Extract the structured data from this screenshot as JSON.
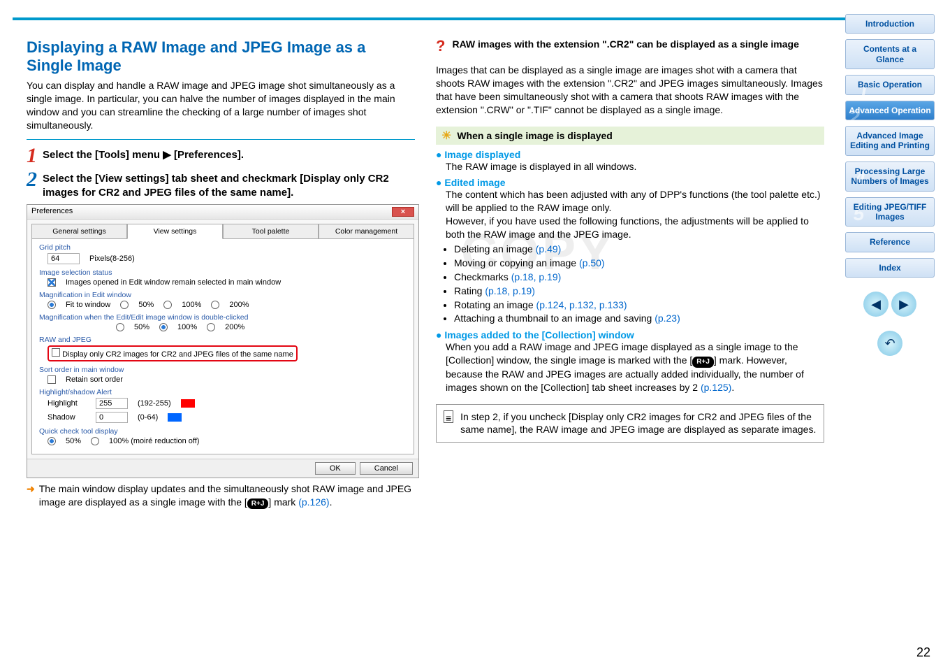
{
  "title": "Displaying a RAW Image and JPEG Image as a Single Image",
  "lead": "You can display and handle a RAW image and JPEG image shot simultaneously as a single image. In particular, you can halve the number of images displayed in the main window and you can streamline the checking of a large number of images shot simultaneously.",
  "step1": "Select the [Tools] menu ▶ [Preferences].",
  "step2": "Select the [View settings] tab sheet and checkmark [Display only CR2 images for CR2 and JPEG files of the same name].",
  "dlg": {
    "title": "Preferences",
    "tabs": [
      "General settings",
      "View settings",
      "Tool palette",
      "Color management"
    ],
    "grid_pitch": {
      "label": "Grid pitch",
      "value": "64",
      "hint": "Pixels(8-256)"
    },
    "sel_status": {
      "label": "Image selection status",
      "chk": "Images opened in Edit window remain selected in main window"
    },
    "mag_edit": {
      "label": "Magnification in Edit window",
      "opts": [
        "Fit to window",
        "50%",
        "100%",
        "200%"
      ]
    },
    "mag_dbl": {
      "label": "Magnification when the Edit/Edit image window is double-clicked",
      "opts": [
        "50%",
        "100%",
        "200%"
      ]
    },
    "rawjpeg": {
      "label": "RAW and JPEG",
      "chk": "Display only CR2 images for CR2 and JPEG files of the same name"
    },
    "sort": {
      "label": "Sort order in main window",
      "chk": "Retain sort order"
    },
    "hl": {
      "label": "Highlight/shadow Alert",
      "hi": "Highlight",
      "hiv": "255",
      "hir": "(192-255)",
      "sh": "Shadow",
      "shv": "0",
      "shr": "(0-64)"
    },
    "quick": {
      "label": "Quick check tool display",
      "o1": "50%",
      "o2": "100% (moiré reduction off)"
    },
    "ok": "OK",
    "cancel": "Cancel"
  },
  "after": "The main window display updates and the simultaneously shot RAW image and JPEG image are displayed as a single image with the [",
  "after2": "] mark ",
  "after_link": "(p.126)",
  "after3": ".",
  "rcol": {
    "q": "RAW images with the extension \".CR2\" can be displayed as a single image",
    "qbody": "Images that can be displayed as a single image are images shot with a camera that shoots RAW images with the extension \".CR2\" and JPEG images simultaneously. Images that have been simultaneously shot with a camera that shoots RAW images with the extension \".CRW\" or \".TIF\" cannot be displayed as a single image.",
    "tip": "When a single image is displayed",
    "disp_h": "Image displayed",
    "disp": "The RAW image is displayed in all windows.",
    "edit_h": "Edited image",
    "edit": "The content which has been adjusted with any of DPP's functions (the tool palette etc.) will be applied to the RAW image only.\nHowever, if you have used the following functions, the adjustments will be applied to both the RAW image and the JPEG image.",
    "items": [
      {
        "t": "Deleting an image ",
        "l": "(p.49)"
      },
      {
        "t": "Moving or copying an image ",
        "l": "(p.50)"
      },
      {
        "t": "Checkmarks ",
        "l": "(p.18, p.19)"
      },
      {
        "t": "Rating ",
        "l": "(p.18, p.19)"
      },
      {
        "t": "Rotating an image ",
        "l": "(p.124, p.132, p.133)"
      },
      {
        "t": "Attaching a thumbnail to an image and saving ",
        "l": "(p.23)"
      }
    ],
    "coll_h": "Images added to the [Collection] window",
    "coll": "When you add a RAW image and JPEG image displayed as a single image to the [Collection] window, the single image is marked with the [",
    "coll2": "] mark. However, because the RAW and JPEG images are actually added individually, the number of images shown on the [Collection] tab sheet increases by 2 ",
    "coll_link": "(p.125)",
    "coll3": ".",
    "note": "In step 2, if you uncheck [Display only CR2 images for CR2 and JPEG files of the same name], the RAW image and JPEG image are displayed as separate images."
  },
  "nav": [
    "Introduction",
    "Contents at a Glance",
    "Basic Operation",
    "Advanced Operation",
    "Advanced Image Editing and Printing",
    "Processing Large Numbers of Images",
    "Editing JPEG/TIFF Images",
    "Reference",
    "Index"
  ],
  "pagenum": "22",
  "rj": "R+J"
}
